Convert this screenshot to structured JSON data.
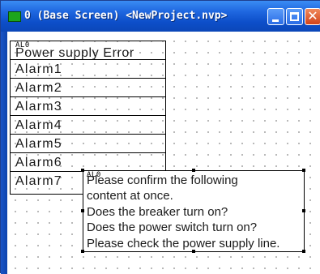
{
  "window": {
    "title": "0 (Base Screen) <NewProject.nvp>",
    "buttons": {
      "minimize": "minimize",
      "maximize": "maximize",
      "close": "✕"
    }
  },
  "alarm_list": {
    "tag": "AL0",
    "header": "Power supply Error",
    "items": [
      "Alarm1",
      "Alarm2",
      "Alarm3",
      "Alarm4",
      "Alarm5",
      "Alarm6",
      "Alarm7"
    ]
  },
  "message_box": {
    "tag": "AL0",
    "lines": [
      "Please confirm the following",
      "content at once.",
      "Does the breaker turn on?",
      "Does the power switch turn on?",
      "Please check the power supply line."
    ]
  },
  "colors": {
    "titlebar": "#1f67e0",
    "close_button": "#d2431a",
    "app_icon": "#1da51d",
    "grid_dot": "#7a7a7a"
  }
}
